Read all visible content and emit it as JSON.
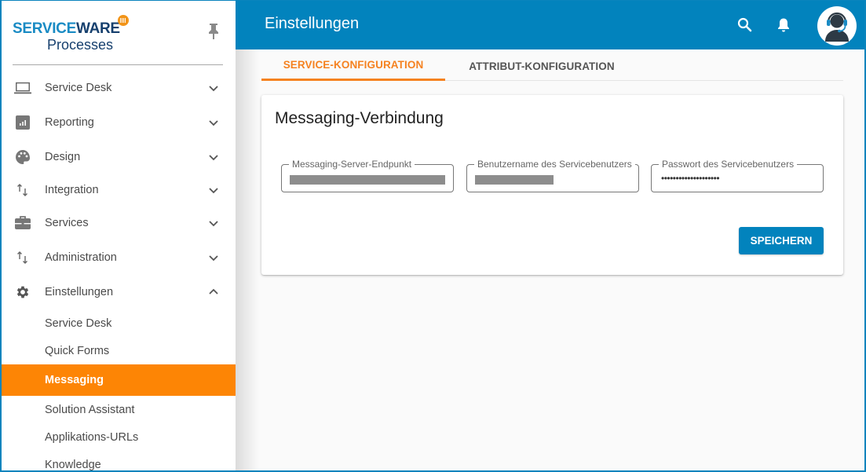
{
  "logo": {
    "brand_part1": "SERVICE",
    "brand_part2": "WARE",
    "product": "Processes"
  },
  "sidebar": {
    "items": [
      {
        "label": "Service Desk",
        "icon": "laptop-icon",
        "expanded": false
      },
      {
        "label": "Reporting",
        "icon": "bar-chart-icon",
        "expanded": false
      },
      {
        "label": "Design",
        "icon": "palette-icon",
        "expanded": false
      },
      {
        "label": "Integration",
        "icon": "swap-vertical-icon",
        "expanded": false
      },
      {
        "label": "Services",
        "icon": "briefcase-icon",
        "expanded": false
      },
      {
        "label": "Administration",
        "icon": "swap-vertical-icon",
        "expanded": false
      },
      {
        "label": "Einstellungen",
        "icon": "gear-icon",
        "expanded": true
      }
    ],
    "sub_items": [
      {
        "label": "Service Desk",
        "active": false
      },
      {
        "label": "Quick Forms",
        "active": false
      },
      {
        "label": "Messaging",
        "active": true
      },
      {
        "label": "Solution Assistant",
        "active": false
      },
      {
        "label": "Applikations-URLs",
        "active": false
      },
      {
        "label": "Knowledge",
        "active": false
      }
    ]
  },
  "header": {
    "title": "Einstellungen"
  },
  "tabs": [
    {
      "label": "SERVICE-KONFIGURATION",
      "active": true
    },
    {
      "label": "ATTRIBUT-KONFIGURATION",
      "active": false
    }
  ],
  "card": {
    "title": "Messaging-Verbindung",
    "fields": [
      {
        "label": "Messaging-Server-Endpunkt",
        "value": "[redacted]"
      },
      {
        "label": "Benutzername des Servicebenutzers",
        "value": "[redacted]"
      },
      {
        "label": "Passwort des Servicebenutzers",
        "value": "••••••••••••••••••••"
      }
    ],
    "save_label": "SPEICHERN"
  },
  "colors": {
    "primary": "#0283bd",
    "accent": "#fd8505",
    "tab_active": "#f58220"
  }
}
